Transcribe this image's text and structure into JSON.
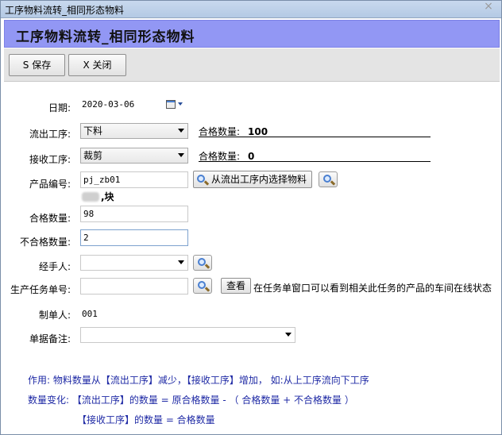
{
  "window": {
    "title": "工序物料流转_相同形态物料",
    "close_glyph": "×"
  },
  "header": {
    "title": "工序物料流转_相同形态物料"
  },
  "toolbar": {
    "save_label": "S 保存",
    "close_label": "X 关闭"
  },
  "form": {
    "date": {
      "label": "日期:",
      "value": "2020-03-06"
    },
    "out_process": {
      "label": "流出工序:",
      "value": "下料",
      "qty_label": "合格数量:",
      "qty_value": "100"
    },
    "in_process": {
      "label": "接收工序:",
      "value": "裁剪",
      "qty_label": "合格数量:",
      "qty_value": "0"
    },
    "product_code": {
      "label": "产品编号:",
      "value": "pj_zb01",
      "select_button": "从流出工序内选择物料",
      "name_suffix": ",块"
    },
    "qualified_qty": {
      "label": "合格数量:",
      "value": "98"
    },
    "unqualified_qty": {
      "label": "不合格数量:",
      "value": "2"
    },
    "handler": {
      "label": "经手人:",
      "value": ""
    },
    "task_no": {
      "label": "生产任务单号:",
      "value": "",
      "view_button": "查看",
      "hint": "在任务单窗口可以看到相关此任务的产品的车间在线状态"
    },
    "creator": {
      "label": "制单人:",
      "value": "001"
    },
    "remark": {
      "label": "单据备注:",
      "value": ""
    }
  },
  "notes": {
    "line1": "作用: 物料数量从【流出工序】减少，【接收工序】增加， 如:从上工序流向下工序",
    "line2": "数量变化: 【流出工序】的数量 = 原合格数量 - （ 合格数量 + 不合格数量 ）",
    "line3": "【接收工序】的数量 =  合格数量"
  },
  "colors": {
    "header_band": "#9297f4",
    "note_text": "#1f2aa5"
  }
}
